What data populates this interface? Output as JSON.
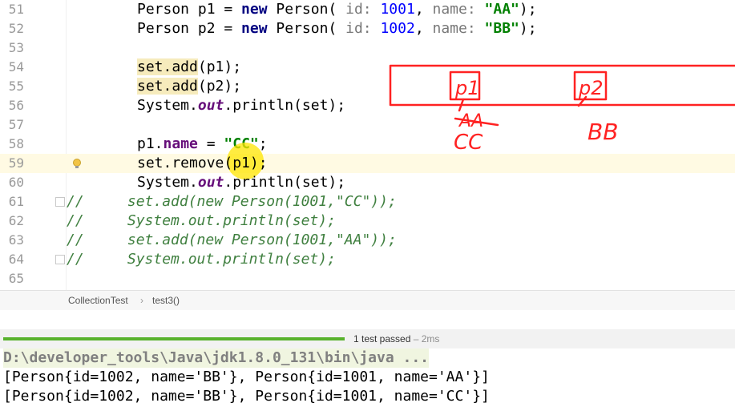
{
  "editor": {
    "lines": [
      {
        "num": "51"
      },
      {
        "num": "52"
      },
      {
        "num": "53"
      },
      {
        "num": "54"
      },
      {
        "num": "55"
      },
      {
        "num": "56"
      },
      {
        "num": "57"
      },
      {
        "num": "58"
      },
      {
        "num": "59"
      },
      {
        "num": "60"
      },
      {
        "num": "61"
      },
      {
        "num": "62"
      },
      {
        "num": "63"
      },
      {
        "num": "64"
      },
      {
        "num": "65"
      }
    ],
    "code": {
      "l51": {
        "a": "Person p1 = ",
        "kw": "new",
        "b": " Person(",
        "hint1": " id:",
        "n1": " 1001",
        ",": ",",
        "hint2": " name:",
        "s": " \"AA\"",
        "end": ");"
      },
      "l52": {
        "a": "Person p2 = ",
        "kw": "new",
        "b": " Person(",
        "hint1": " id:",
        "n1": " 1002",
        ",": ",",
        "hint2": " name:",
        "s": " \"BB\"",
        "end": ");"
      },
      "l54": {
        "hl": "set.add",
        "rest": "(p1);"
      },
      "l55": {
        "hl": "set.add",
        "rest": "(p2);"
      },
      "l56": {
        "a": "System.",
        "st": "out",
        "b": ".println(set);"
      },
      "l58": {
        "a": "p1.",
        "f": "name",
        "b": " = ",
        "s": "\"CC\"",
        "end": ";"
      },
      "l59": {
        "a": "set.remove(p1);"
      },
      "l60": {
        "a": "System.",
        "st": "out",
        "b": ".println(set);"
      },
      "l61": {
        "c": "//     set.add(new Person(1001,\"CC\"));"
      },
      "l62": {
        "c": "//     System.out.println(set);"
      },
      "l63": {
        "c": "//     set.add(new Person(1001,\"AA\"));"
      },
      "l64": {
        "c": "//     System.out.println(set);"
      }
    }
  },
  "annotation": {
    "box1": "p1",
    "box2": "p2",
    "old1": "AA",
    "new1": "CC",
    "val2": "BB"
  },
  "breadcrumb": {
    "class": "CollectionTest",
    "sep": "›",
    "method": "test3()"
  },
  "tests": {
    "status": "1 test passed",
    "sep": " – ",
    "time": "2ms",
    "progress": 1.0
  },
  "console": {
    "cmd": "D:\\developer_tools\\Java\\jdk1.8.0_131\\bin\\java ...",
    "out1": "[Person{id=1002, name='BB'}, Person{id=1001, name='AA'}]",
    "out2": "[Person{id=1002, name='BB'}, Person{id=1001, name='CC'}]"
  },
  "colors": {
    "annotation_red": "#ff2222",
    "progress_green": "#58b22d",
    "cursor_highlight": "#ffe600"
  }
}
